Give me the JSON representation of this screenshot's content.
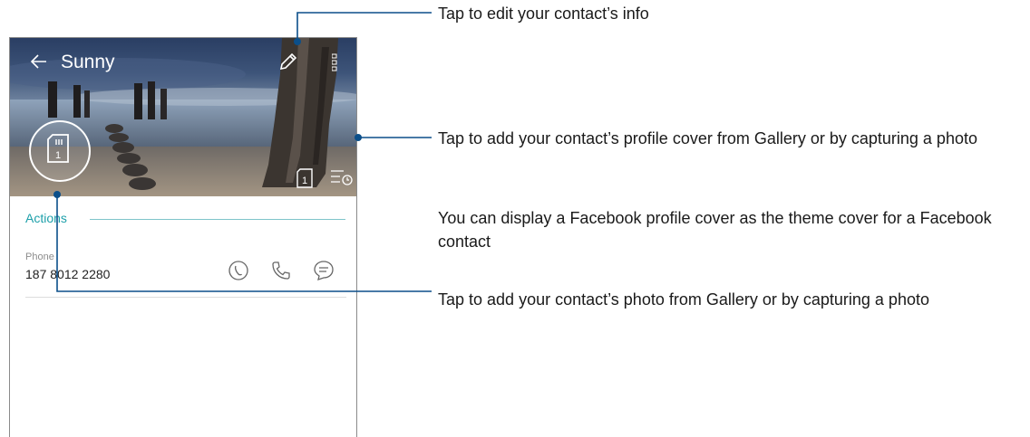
{
  "header": {
    "title": "Sunny",
    "back_icon": "back-arrow-icon",
    "edit_icon": "pencil-icon",
    "more_icon": "more-vertical-icon"
  },
  "cover": {
    "sim_badge": "1",
    "sim_icon": "sim-card-icon",
    "history_icon": "call-history-icon"
  },
  "actions": {
    "section_title": "Actions",
    "phone_label": "Phone",
    "phone_number": "187 8012 2280",
    "icons": [
      "call-history-icon",
      "phone-call-icon",
      "message-icon"
    ]
  },
  "callouts": {
    "edit": "Tap to edit your contact’s info",
    "cover": "Tap to add your contact’s profile cover from Gallery or by capturing a photo",
    "facebook": "You can display a Facebook profile cover as the theme cover for a Facebook contact",
    "photo": "Tap to add your contact’s photo from Gallery or by capturing a photo"
  },
  "colors": {
    "accent": "#1ea0aa",
    "callout_line": "#0b4f8a"
  }
}
